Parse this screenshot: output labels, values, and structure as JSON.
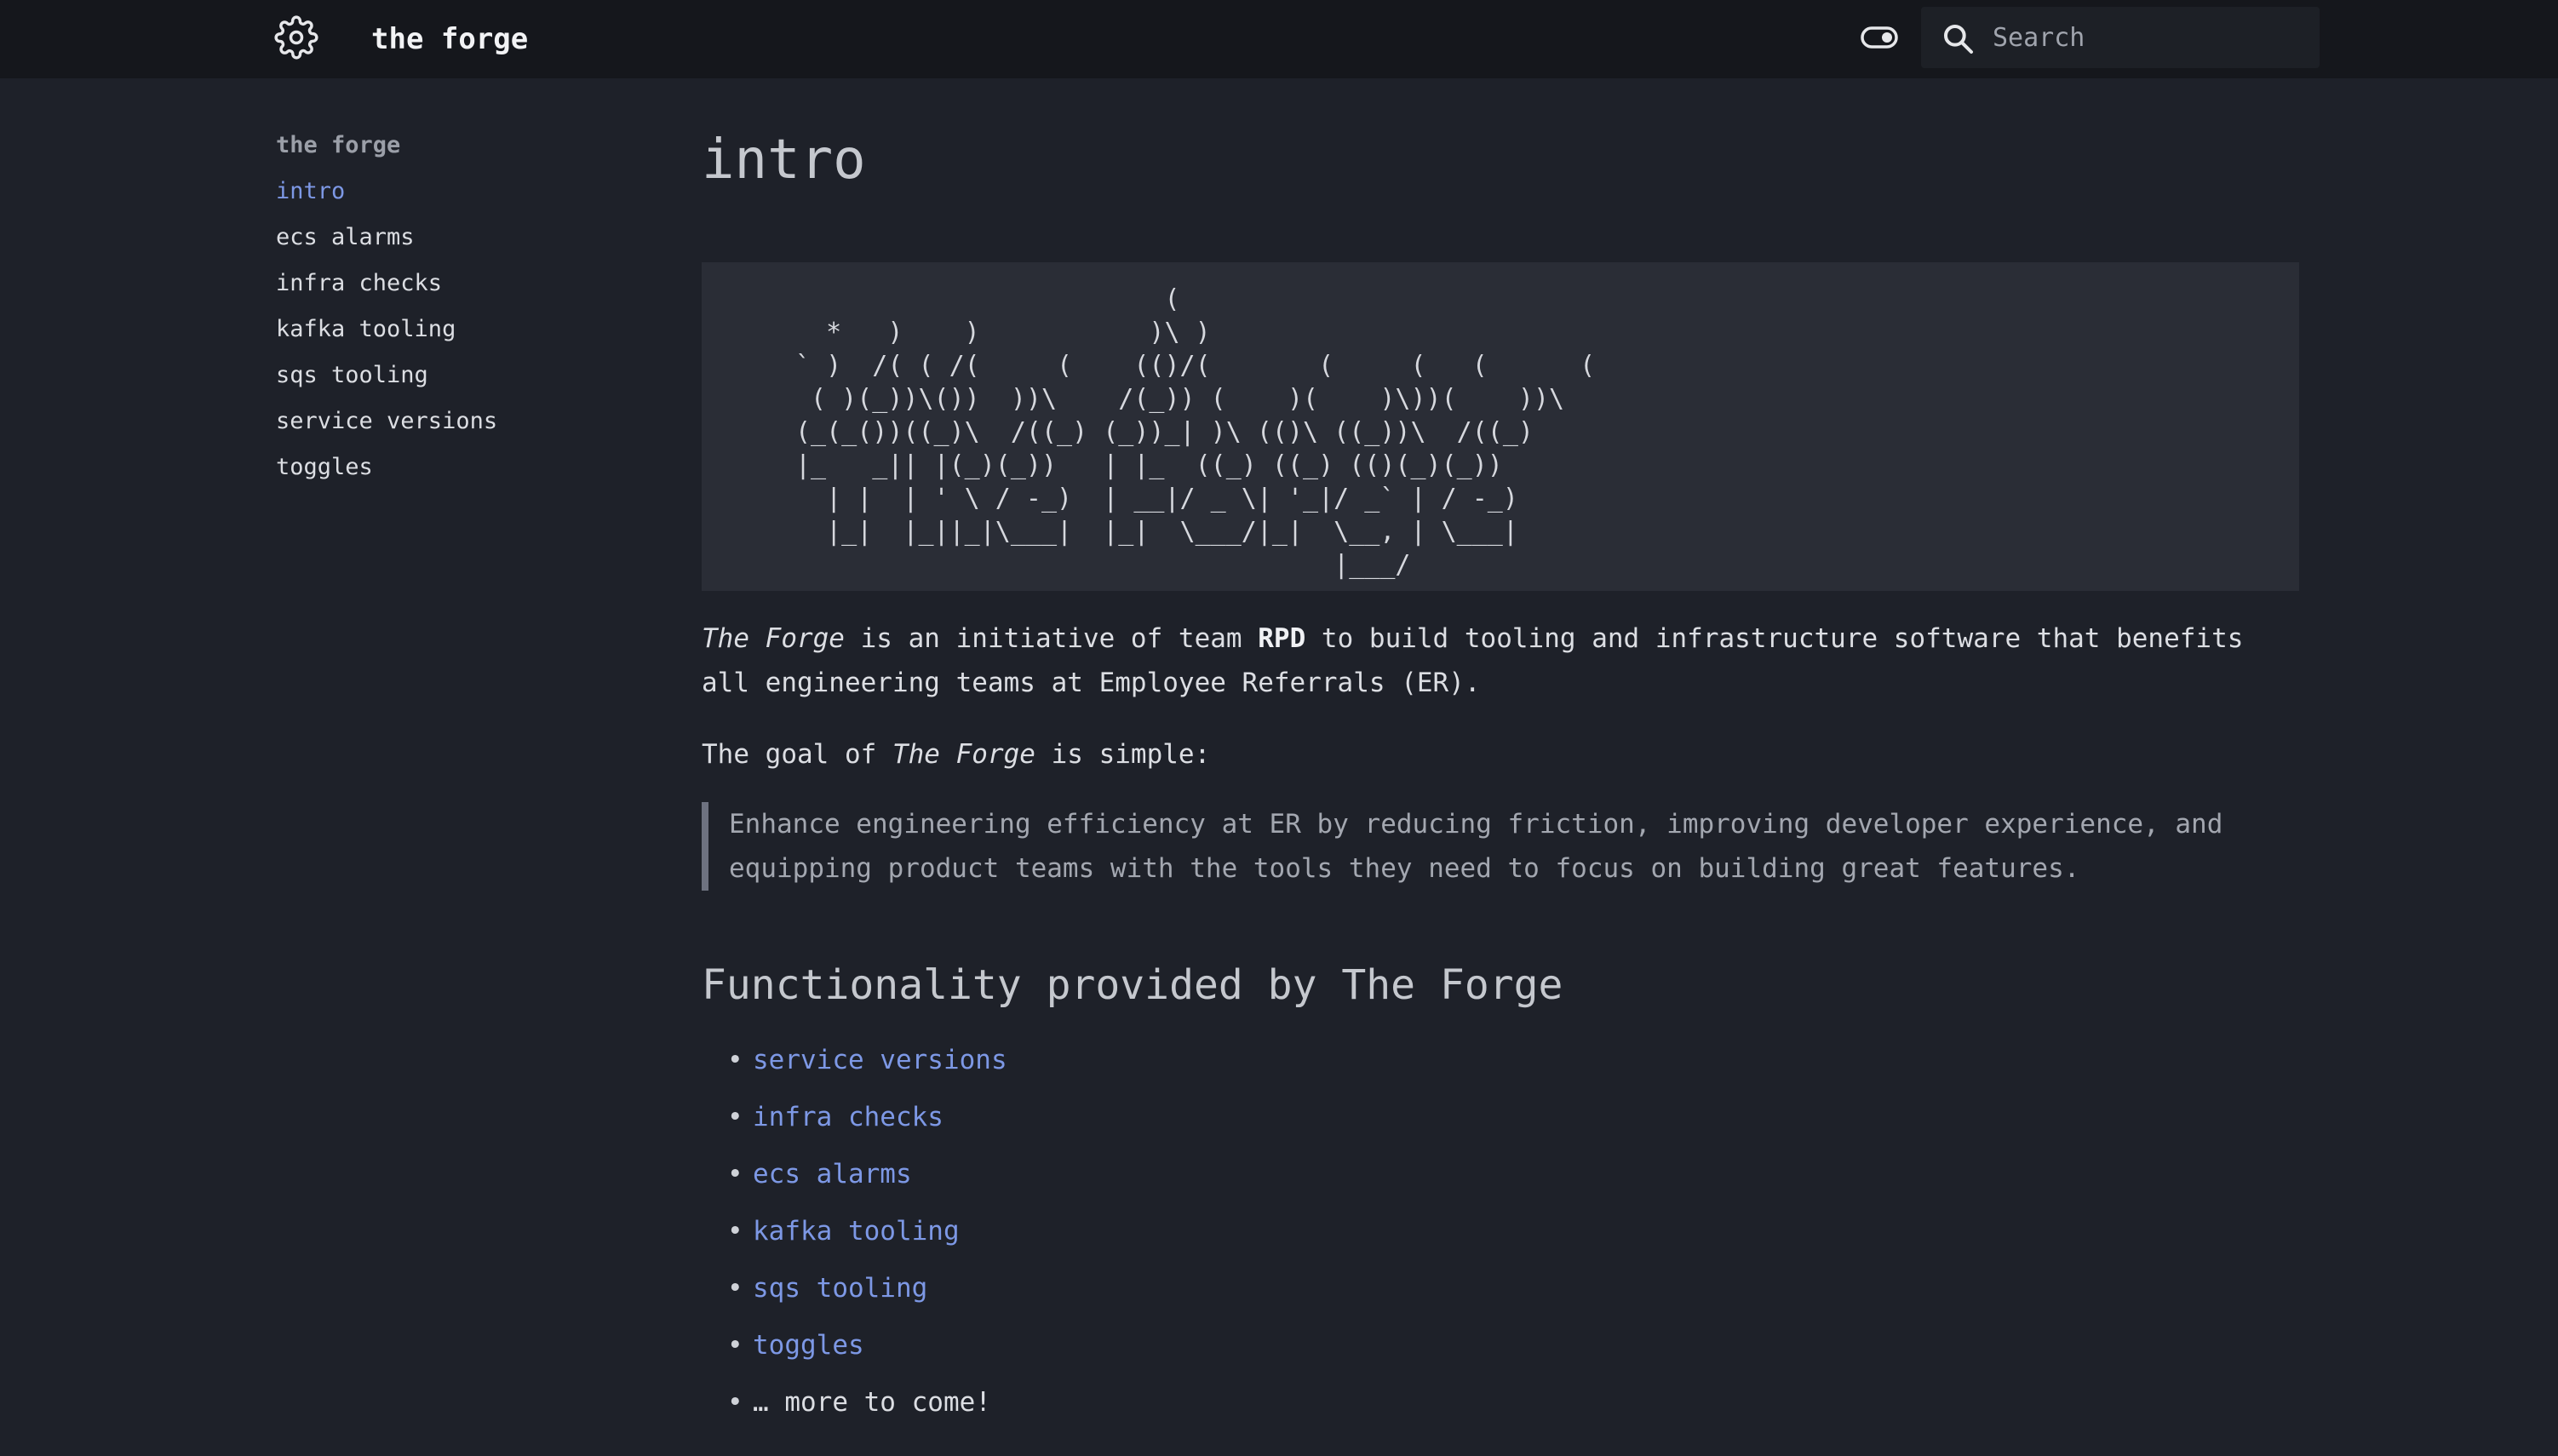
{
  "header": {
    "logo_icon": "gear-icon",
    "title": "the forge",
    "theme_toggle_icon": "toggle-icon",
    "search": {
      "icon": "search-icon",
      "placeholder": "Search",
      "value": ""
    }
  },
  "sidebar": {
    "heading": "the forge",
    "items": [
      {
        "label": "intro",
        "active": true
      },
      {
        "label": "ecs alarms"
      },
      {
        "label": "infra checks"
      },
      {
        "label": "kafka tooling"
      },
      {
        "label": "sqs tooling"
      },
      {
        "label": "service versions"
      },
      {
        "label": "toggles"
      }
    ]
  },
  "main": {
    "title": "intro",
    "ascii_art": "                        (\n  *   )    )           )\\ )\n` )  /( ( /(     (    (()/(       (     (   (      (\n ( )(_))\\())  ))\\    /(_)) (    )(    )\\))(    ))\\\n(_(_())((_)\\  /((_) (_))_| )\\ (()\\ ((_))\\  /((_)\n|_   _|| |(_)(_))   | |_  ((_) ((_) (()(_)(_))\n  | |  | ' \\ / -_)  | __|/ _ \\| '_|/ _` | / -_)\n  |_|  |_||_|\\___|  |_|  \\___/|_|  \\__, | \\___|\n                                   |___/",
    "intro": {
      "name": "The Forge",
      "p1": " is an initiative of team ",
      "team": "RPD",
      "p2": " to build tooling and infrastructure software that benefits all engineering teams at Employee Referrals (ER)."
    },
    "goal": {
      "prefix": "The goal of ",
      "name": "The Forge",
      "suffix": " is simple:"
    },
    "quote": "Enhance engineering efficiency at ER by reducing friction, improving developer experience, and equipping product teams with the tools they need to focus on building great features.",
    "section_heading": "Functionality provided by The Forge",
    "bullet": "•",
    "features": [
      {
        "label": "service versions"
      },
      {
        "label": "infra checks"
      },
      {
        "label": "ecs alarms"
      },
      {
        "label": "kafka tooling"
      },
      {
        "label": "sqs tooling"
      },
      {
        "label": "toggles"
      }
    ],
    "more": "… more to come!"
  },
  "colors": {
    "background": "#1e2129",
    "header_background": "#15171c",
    "link": "#7d98e5",
    "code_background": "#2a2d36"
  }
}
